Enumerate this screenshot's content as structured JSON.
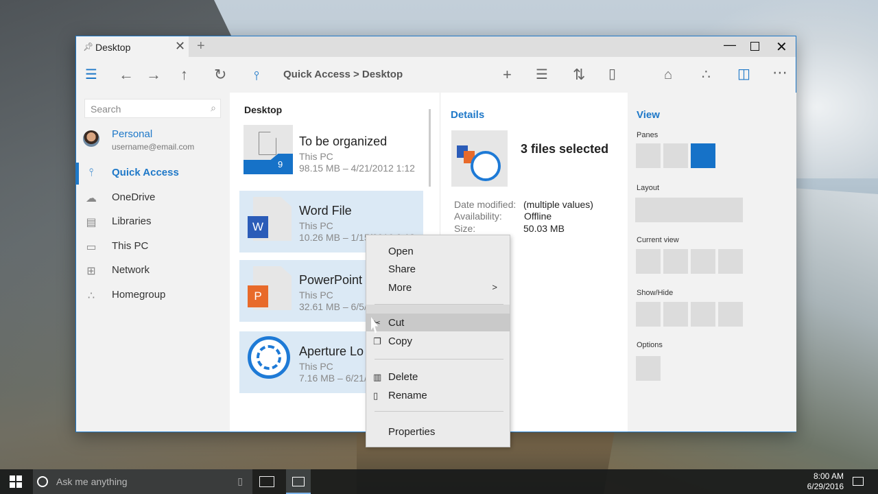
{
  "tab": {
    "title": "Desktop",
    "pin_icon": "pin-icon",
    "close_icon": "close-icon"
  },
  "breadcrumb": "Quick Access > Desktop",
  "search": {
    "placeholder": "Search"
  },
  "account": {
    "name": "Personal",
    "email": "username@email.com"
  },
  "nav": [
    {
      "label": "Quick Access",
      "icon": "pin-icon",
      "active": true
    },
    {
      "label": "OneDrive",
      "icon": "cloud-icon"
    },
    {
      "label": "Libraries",
      "icon": "library-icon"
    },
    {
      "label": "This PC",
      "icon": "monitor-icon"
    },
    {
      "label": "Network",
      "icon": "network-icon"
    },
    {
      "label": "Homegroup",
      "icon": "homegroup-icon"
    }
  ],
  "filelist": {
    "title": "Desktop",
    "files": [
      {
        "name": "To be organized",
        "location": "This PC",
        "meta": "98.15 MB – 4/21/2012 1:12",
        "badge": "9",
        "selected": false
      },
      {
        "name": "Word File",
        "location": "This PC",
        "meta": "10.26 MB – 1/15/2016 9:18",
        "badge": "W",
        "selected": true
      },
      {
        "name": "PowerPoint",
        "location": "This PC",
        "meta": "32.61 MB – 6/5/",
        "badge": "P",
        "selected": true
      },
      {
        "name": "Aperture Lo",
        "location": "This PC",
        "meta": "7.16 MB – 6/21/",
        "badge": "",
        "selected": true
      }
    ]
  },
  "details": {
    "title": "Details",
    "selected_text": "3 files selected",
    "rows": [
      {
        "label": "Date modified:",
        "value": "(multiple values)"
      },
      {
        "label": "Availability:",
        "value": "Offline"
      },
      {
        "label": "Size:",
        "value": "50.03 MB"
      }
    ]
  },
  "view": {
    "title": "View",
    "sections": [
      "Panes",
      "Layout",
      "Current view",
      "Show/Hide",
      "Options"
    ]
  },
  "context_menu": {
    "open": "Open",
    "share": "Share",
    "more": "More",
    "more_arrow": ">",
    "cut": "Cut",
    "copy": "Copy",
    "delete": "Delete",
    "rename": "Rename",
    "properties": "Properties"
  },
  "taskbar": {
    "search_placeholder": "Ask me anything",
    "time": "8:00 AM",
    "date": "6/29/2016"
  },
  "colors": {
    "accent": "#1e78c8",
    "selection": "#dbe9f5",
    "word": "#2b5cb8",
    "powerpoint": "#e86a2a",
    "folder": "#1672c8"
  }
}
